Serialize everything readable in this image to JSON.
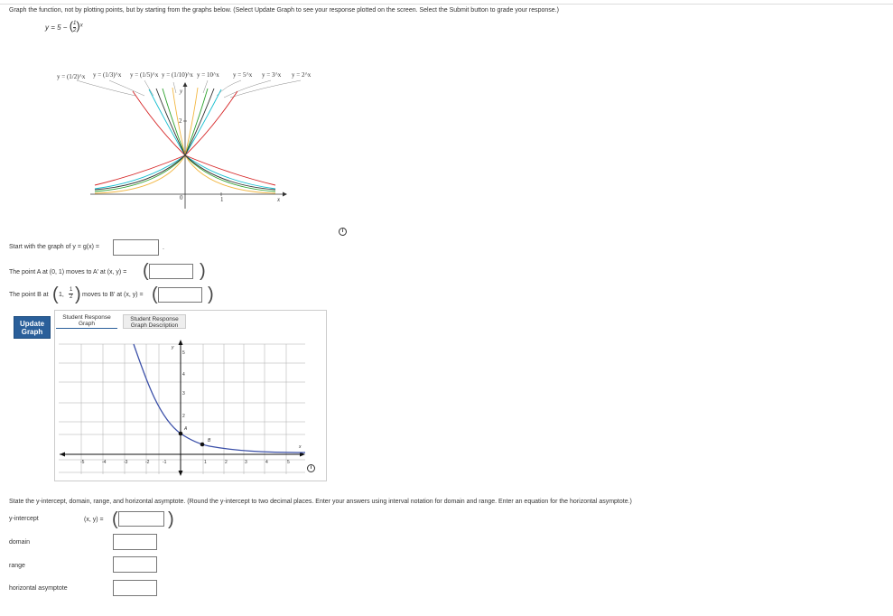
{
  "instructions": "Graph the function, not by plotting points, but by starting from the graphs below. (Select Update Graph to see your response plotted on the screen. Select the Submit button to grade your response.)",
  "function": {
    "lhs": "y = 5 −",
    "base_num": "1",
    "base_den": "2",
    "exp": "x"
  },
  "reference_graph": {
    "labels": [
      "y = (1/2)^x",
      "y = (1/3)^x",
      "y = (1/5)^x",
      "y = (1/10)^x",
      "y = 10^x",
      "y = 5^x",
      "y = 3^x",
      "y = 2^x"
    ],
    "y_axis_label": "y",
    "x_axis_label": "x",
    "y_tick": "2",
    "origin_label": "0",
    "x_tick": "1",
    "colors": {
      "base2": "#d62728",
      "base3": "#17becf",
      "base5": "#2ca02c",
      "base10": "#f2b640",
      "dark": "#333333"
    }
  },
  "questions": {
    "start": {
      "prefix": "Start with the graph of y = g(x) =",
      "suffix": "."
    },
    "pointA": {
      "text": "The point A at (0, 1) moves to A′ at (x, y) ="
    },
    "pointB": {
      "prefix": "The point B at",
      "coord_open": "1,",
      "frac_num": "1",
      "frac_den": "2",
      "suffix": "moves to B′ at (x, y) ="
    }
  },
  "update_button": "Update Graph",
  "tabs": {
    "graph": "Student Response Graph",
    "description": "Student Response Graph Description"
  },
  "response_graph": {
    "x_labels": [
      "-5",
      "-4",
      "-3",
      "-2",
      "-1",
      "1",
      "2",
      "3",
      "4",
      "5"
    ],
    "y_labels": [
      "5",
      "4",
      "3",
      "2"
    ],
    "x_axis_label": "x",
    "y_axis_label": "y",
    "point_A_label": "A",
    "point_B_label": "B",
    "curve_color": "#3a4fa8"
  },
  "state_prompt": "State the y-intercept, domain, range, and horizontal asymptote. (Round the y-intercept to two decimal places. Enter your answers using interval notation for domain and range. Enter an equation for the horizontal asymptote.)",
  "answers": {
    "y_intercept_label": "y-intercept",
    "xy_label": "(x, y) =",
    "domain_label": "domain",
    "range_label": "range",
    "asymptote_label": "horizontal asymptote"
  }
}
